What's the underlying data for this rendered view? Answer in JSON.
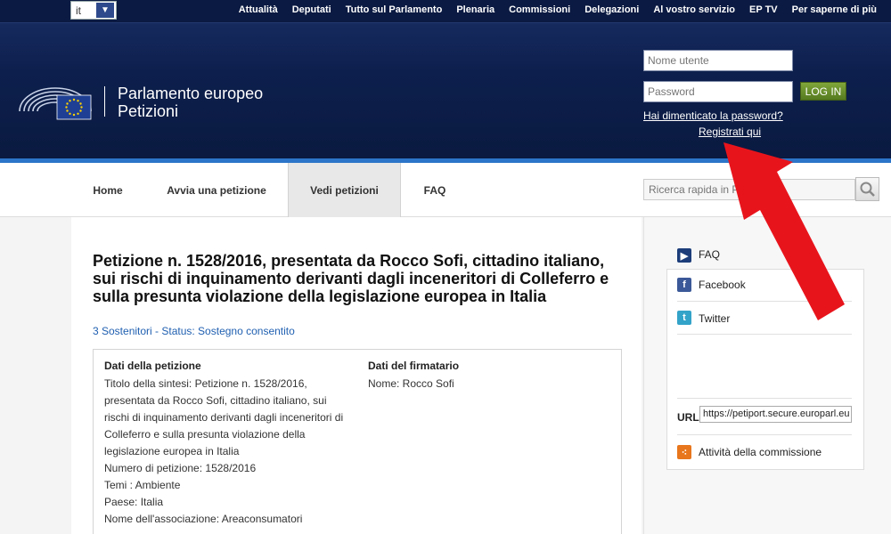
{
  "header": {
    "language": "it",
    "menu": [
      "Attualità",
      "Deputati",
      "Tutto sul Parlamento",
      "Plenaria",
      "Commissioni",
      "Delegazioni",
      "Al vostro servizio",
      "EP TV",
      "Per saperne di più"
    ],
    "logo_line1": "Parlamento europeo",
    "logo_line2": "Petizioni",
    "username_placeholder": "Nome utente",
    "password_placeholder": "Password",
    "login_label": "LOG IN",
    "forgot_password": "Hai dimenticato la password?",
    "register": "Registrati qui"
  },
  "nav": {
    "home": "Home",
    "start_petition": "Avvia una petizione",
    "view_petitions": "Vedi petizioni",
    "faq": "FAQ",
    "search_placeholder": "Ricerca rapida in Petizioni"
  },
  "petition": {
    "title": "Petizione n. 1528/2016, presentata da Rocco Sofi, cittadino italiano, sui rischi di inquinamento derivanti dagli inceneritori di Colleferro e sulla presunta violazione della legislazione europea in Italia",
    "status_line": "3 Sostenitori - Status: Sostegno consentito",
    "details_heading": "Dati della petizione",
    "details_lines": [
      "Titolo della sintesi: Petizione n. 1528/2016,",
      "presentata da Rocco Sofi, cittadino italiano, sui",
      "rischi di inquinamento derivanti dagli inceneritori di",
      "Colleferro e sulla presunta violazione della",
      "legislazione europea in Italia",
      "Numero di petizione: 1528/2016",
      "Temi : Ambiente",
      "Paese: Italia",
      "Nome dell'associazione: Areaconsumatori"
    ],
    "signatory_heading": "Dati del firmatario",
    "signatory_name": "Nome: Rocco Sofi"
  },
  "sidebar": {
    "faq": "FAQ",
    "facebook": "Facebook",
    "twitter": "Twitter",
    "url_label": "URL",
    "url_value": "https://petiport.secure.europarl.eu",
    "activity": "Attività della commissione"
  },
  "colors": {
    "header_dark": "#0d1f4d",
    "accent_blue": "#2c75c9",
    "login_green": "#6a9330",
    "annotation_arrow": "#e8141c"
  }
}
